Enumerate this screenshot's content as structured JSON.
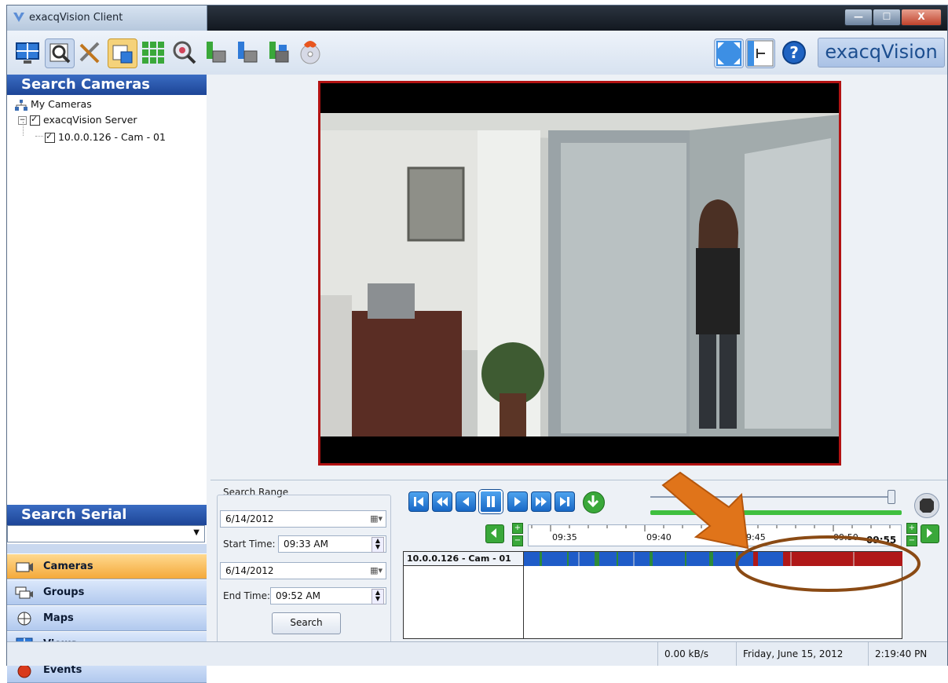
{
  "window": {
    "title": "exacqVision Client",
    "buttons": {
      "minimize": "—",
      "maximize": "☐",
      "close": "X"
    }
  },
  "toolbar": {
    "logo_text": "exacqVision"
  },
  "sidebar": {
    "search_cameras_title": "Search Cameras",
    "tree": {
      "root": "My Cameras",
      "server": "exacqVision Server",
      "camera": "10.0.0.126 - Cam - 01"
    },
    "search_serial_title": "Search Serial",
    "nav": [
      {
        "label": "Cameras",
        "active": true
      },
      {
        "label": "Groups",
        "active": false
      },
      {
        "label": "Maps",
        "active": false
      },
      {
        "label": "Views",
        "active": false
      },
      {
        "label": "Events",
        "active": false
      }
    ]
  },
  "search": {
    "range_label": "Search Range",
    "start_date": "6/14/2012",
    "start_time_label": "Start Time:",
    "start_time": "09:33 AM",
    "end_date": "6/14/2012",
    "end_time_label": "End Time:",
    "end_time": "09:52 AM",
    "button": "Search"
  },
  "timeline": {
    "ticks": [
      "09:35",
      "09:40",
      "09:45",
      "09:50"
    ],
    "current": "09:55",
    "track_label": "10.0.0.126 - Cam - 01"
  },
  "status": {
    "rate": "0.00 kB/s",
    "date": "Friday, June 15, 2012",
    "time": "2:19:40 PN"
  },
  "colors": {
    "accent_blue": "#1d4597",
    "recording_blue": "#1f5cc8",
    "motion_red": "#b01818",
    "annotation_arrow": "#e0741a",
    "annotation_ellipse": "#8a4a14"
  }
}
